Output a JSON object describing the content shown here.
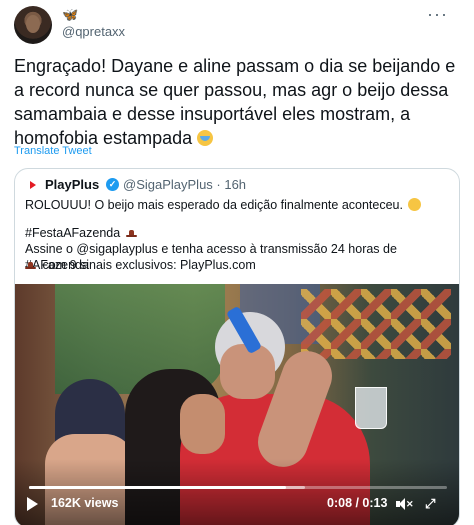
{
  "tweet": {
    "handle": "@qpretaxx",
    "butterfly_icon": "butterfly-icon",
    "more_icon": "more-options-icon",
    "text": "Engraçado! Dayane e aline passam o dia se beijando e a record nunca se quer passou, mas agr o beijo dessa samambaia e desse insuportável eles mostram, a homofobia estampada",
    "emoji_icon": "nauseated-face-icon",
    "translate_label": "Translate Tweet"
  },
  "quote": {
    "account_name": "PlayPlus",
    "handle_time": "@SigaPlayPlus · 16h",
    "verified_icon": "verified-badge-icon",
    "line1": "ROLOUUU! O beijo mais esperado da edição finalmente aconteceu.",
    "line2": "#FestaAFazenda",
    "line3": "Assine o @sigaplayplus e tenha acesso à transmissão 24 horas de #AFazenda",
    "line4": "com 9 sinais exclusivos: PlayPlus.com",
    "hat_icon": "cowboy-hat-icon",
    "hug_icon": "smiling-hearts-face-icon"
  },
  "video": {
    "views": "162K views",
    "time": "0:08 / 0:13",
    "progress_fraction": 0.615,
    "play_icon": "play-icon",
    "mute_icon": "muted-speaker-icon",
    "fullscreen_icon": "fullscreen-icon"
  },
  "colors": {
    "link_blue": "#1d9bf0",
    "text_dark": "#0f1419",
    "text_muted": "#536471",
    "border": "#cfd9de",
    "brand_red": "#e31b23"
  }
}
